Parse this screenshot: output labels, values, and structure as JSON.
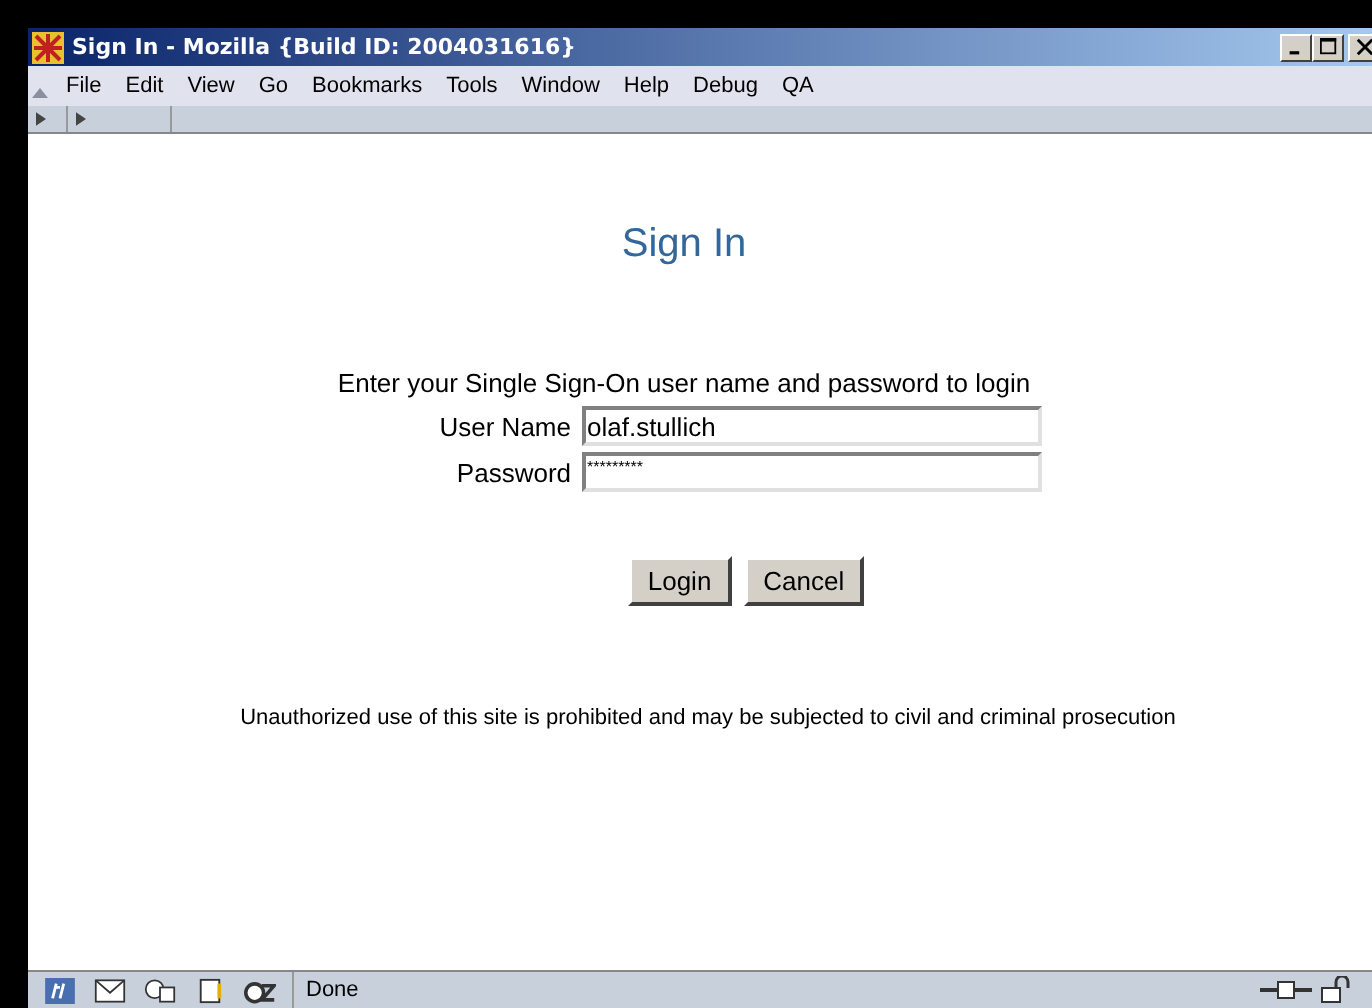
{
  "window": {
    "title": "Sign In - Mozilla {Build ID: 2004031616}"
  },
  "menu": [
    "File",
    "Edit",
    "View",
    "Go",
    "Bookmarks",
    "Tools",
    "Window",
    "Help",
    "Debug",
    "QA"
  ],
  "page": {
    "heading": "Sign In",
    "instructions": "Enter your Single Sign-On user name and password to login",
    "fields": [
      {
        "label": "User Name",
        "value": "olaf.stullich"
      },
      {
        "label": "Password",
        "value": "*********"
      }
    ],
    "buttons": [
      "Login",
      "Cancel"
    ],
    "notice": "Unauthorized use of this site is prohibited and may be subjected to civil and criminal prosecution"
  },
  "status_bar": {
    "text": "Done"
  }
}
